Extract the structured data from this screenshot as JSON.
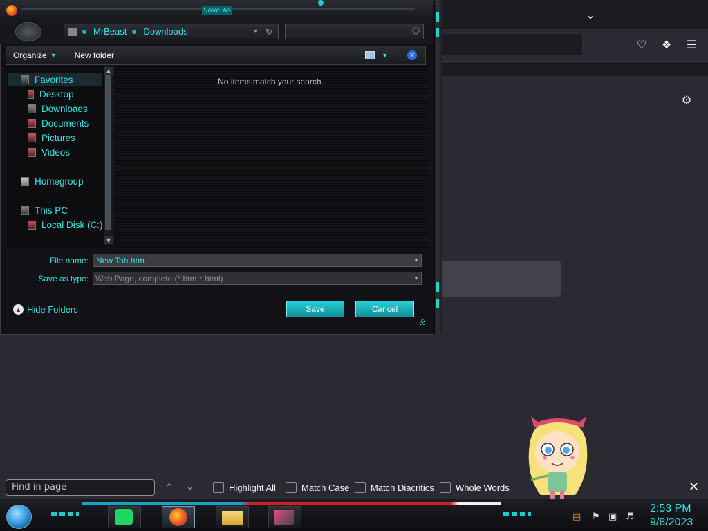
{
  "dialog": {
    "title": "Save As",
    "breadcrumb": [
      "MrBeast",
      "Downloads"
    ],
    "toolbar": {
      "organize": "Organize",
      "new_folder": "New folder",
      "help": "?"
    },
    "nav": {
      "favorites": "Favorites",
      "desktop": "Desktop",
      "downloads": "Downloads",
      "documents": "Documents",
      "pictures": "Pictures",
      "videos": "Videos",
      "homegroup": "Homegroup",
      "this_pc": "This PC",
      "local_disk": "Local Disk (C:)"
    },
    "empty_message": "No items match your search.",
    "file_name_label": "File name:",
    "file_name_value": "New Tab.htm",
    "save_type_label": "Save as type:",
    "save_type_value": "Web Page, complete (*.htm;*.html)",
    "hide_folders": "Hide Folders",
    "save_button": "Save",
    "cancel_button": "Cancel"
  },
  "findbar": {
    "placeholder": "Find in page",
    "highlight_all": "Highlight All",
    "match_case": "Match Case",
    "match_diacritics": "Match Diacritics",
    "whole_words": "Whole Words"
  },
  "taskbar": {
    "time": "2:53 PM",
    "date": "9/8/2023",
    "apps": [
      "spotify-icon",
      "firefox-icon",
      "file-explorer-icon",
      "media-icon"
    ]
  },
  "colors": {
    "accent": "#2ee6e6",
    "browser_bg": "#2b2a33",
    "dialog_bg": "#121216"
  }
}
